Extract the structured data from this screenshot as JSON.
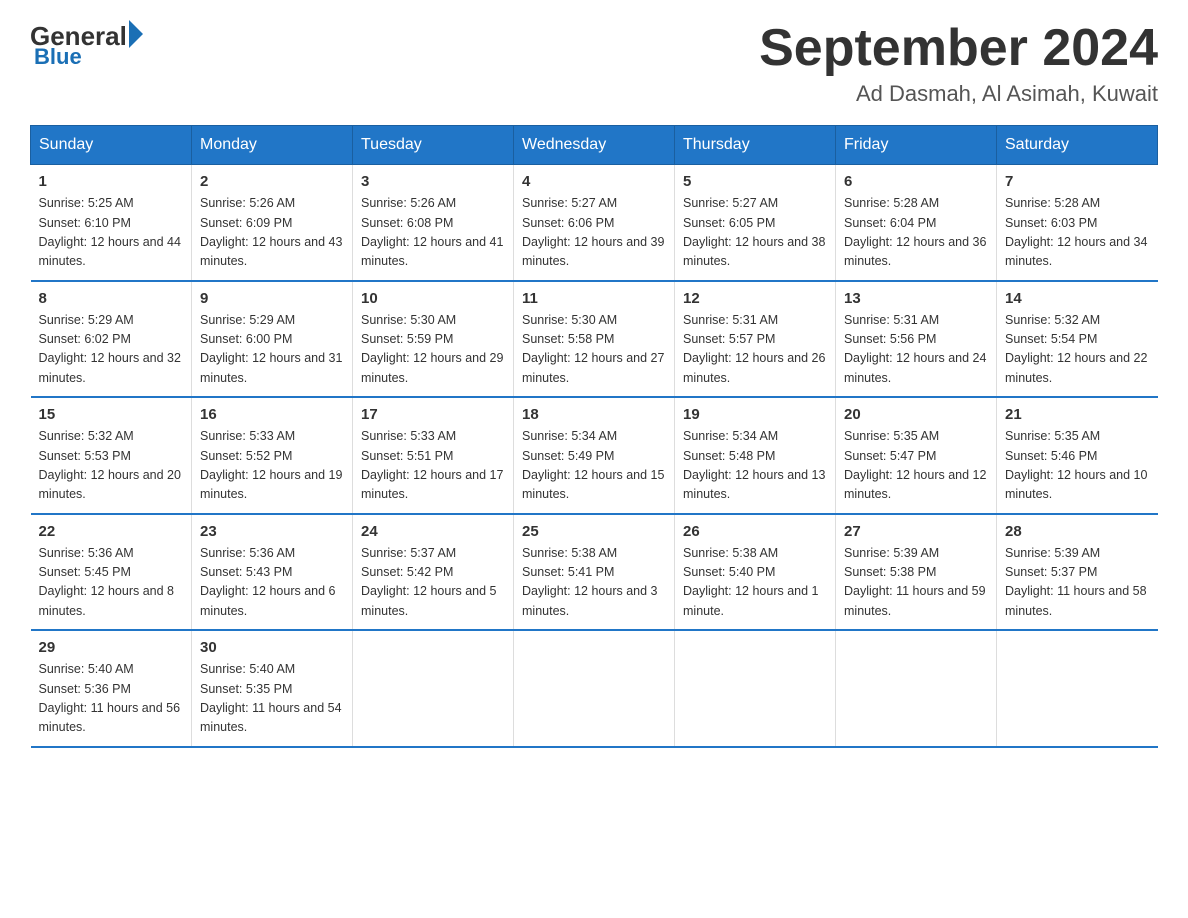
{
  "logo": {
    "general": "General",
    "triangle": "▶",
    "blue": "Blue"
  },
  "header": {
    "month": "September 2024",
    "location": "Ad Dasmah, Al Asimah, Kuwait"
  },
  "weekdays": [
    "Sunday",
    "Monday",
    "Tuesday",
    "Wednesday",
    "Thursday",
    "Friday",
    "Saturday"
  ],
  "weeks": [
    [
      {
        "day": "1",
        "sunrise": "5:25 AM",
        "sunset": "6:10 PM",
        "daylight": "12 hours and 44 minutes."
      },
      {
        "day": "2",
        "sunrise": "5:26 AM",
        "sunset": "6:09 PM",
        "daylight": "12 hours and 43 minutes."
      },
      {
        "day": "3",
        "sunrise": "5:26 AM",
        "sunset": "6:08 PM",
        "daylight": "12 hours and 41 minutes."
      },
      {
        "day": "4",
        "sunrise": "5:27 AM",
        "sunset": "6:06 PM",
        "daylight": "12 hours and 39 minutes."
      },
      {
        "day": "5",
        "sunrise": "5:27 AM",
        "sunset": "6:05 PM",
        "daylight": "12 hours and 38 minutes."
      },
      {
        "day": "6",
        "sunrise": "5:28 AM",
        "sunset": "6:04 PM",
        "daylight": "12 hours and 36 minutes."
      },
      {
        "day": "7",
        "sunrise": "5:28 AM",
        "sunset": "6:03 PM",
        "daylight": "12 hours and 34 minutes."
      }
    ],
    [
      {
        "day": "8",
        "sunrise": "5:29 AM",
        "sunset": "6:02 PM",
        "daylight": "12 hours and 32 minutes."
      },
      {
        "day": "9",
        "sunrise": "5:29 AM",
        "sunset": "6:00 PM",
        "daylight": "12 hours and 31 minutes."
      },
      {
        "day": "10",
        "sunrise": "5:30 AM",
        "sunset": "5:59 PM",
        "daylight": "12 hours and 29 minutes."
      },
      {
        "day": "11",
        "sunrise": "5:30 AM",
        "sunset": "5:58 PM",
        "daylight": "12 hours and 27 minutes."
      },
      {
        "day": "12",
        "sunrise": "5:31 AM",
        "sunset": "5:57 PM",
        "daylight": "12 hours and 26 minutes."
      },
      {
        "day": "13",
        "sunrise": "5:31 AM",
        "sunset": "5:56 PM",
        "daylight": "12 hours and 24 minutes."
      },
      {
        "day": "14",
        "sunrise": "5:32 AM",
        "sunset": "5:54 PM",
        "daylight": "12 hours and 22 minutes."
      }
    ],
    [
      {
        "day": "15",
        "sunrise": "5:32 AM",
        "sunset": "5:53 PM",
        "daylight": "12 hours and 20 minutes."
      },
      {
        "day": "16",
        "sunrise": "5:33 AM",
        "sunset": "5:52 PM",
        "daylight": "12 hours and 19 minutes."
      },
      {
        "day": "17",
        "sunrise": "5:33 AM",
        "sunset": "5:51 PM",
        "daylight": "12 hours and 17 minutes."
      },
      {
        "day": "18",
        "sunrise": "5:34 AM",
        "sunset": "5:49 PM",
        "daylight": "12 hours and 15 minutes."
      },
      {
        "day": "19",
        "sunrise": "5:34 AM",
        "sunset": "5:48 PM",
        "daylight": "12 hours and 13 minutes."
      },
      {
        "day": "20",
        "sunrise": "5:35 AM",
        "sunset": "5:47 PM",
        "daylight": "12 hours and 12 minutes."
      },
      {
        "day": "21",
        "sunrise": "5:35 AM",
        "sunset": "5:46 PM",
        "daylight": "12 hours and 10 minutes."
      }
    ],
    [
      {
        "day": "22",
        "sunrise": "5:36 AM",
        "sunset": "5:45 PM",
        "daylight": "12 hours and 8 minutes."
      },
      {
        "day": "23",
        "sunrise": "5:36 AM",
        "sunset": "5:43 PM",
        "daylight": "12 hours and 6 minutes."
      },
      {
        "day": "24",
        "sunrise": "5:37 AM",
        "sunset": "5:42 PM",
        "daylight": "12 hours and 5 minutes."
      },
      {
        "day": "25",
        "sunrise": "5:38 AM",
        "sunset": "5:41 PM",
        "daylight": "12 hours and 3 minutes."
      },
      {
        "day": "26",
        "sunrise": "5:38 AM",
        "sunset": "5:40 PM",
        "daylight": "12 hours and 1 minute."
      },
      {
        "day": "27",
        "sunrise": "5:39 AM",
        "sunset": "5:38 PM",
        "daylight": "11 hours and 59 minutes."
      },
      {
        "day": "28",
        "sunrise": "5:39 AM",
        "sunset": "5:37 PM",
        "daylight": "11 hours and 58 minutes."
      }
    ],
    [
      {
        "day": "29",
        "sunrise": "5:40 AM",
        "sunset": "5:36 PM",
        "daylight": "11 hours and 56 minutes."
      },
      {
        "day": "30",
        "sunrise": "5:40 AM",
        "sunset": "5:35 PM",
        "daylight": "11 hours and 54 minutes."
      },
      null,
      null,
      null,
      null,
      null
    ]
  ]
}
